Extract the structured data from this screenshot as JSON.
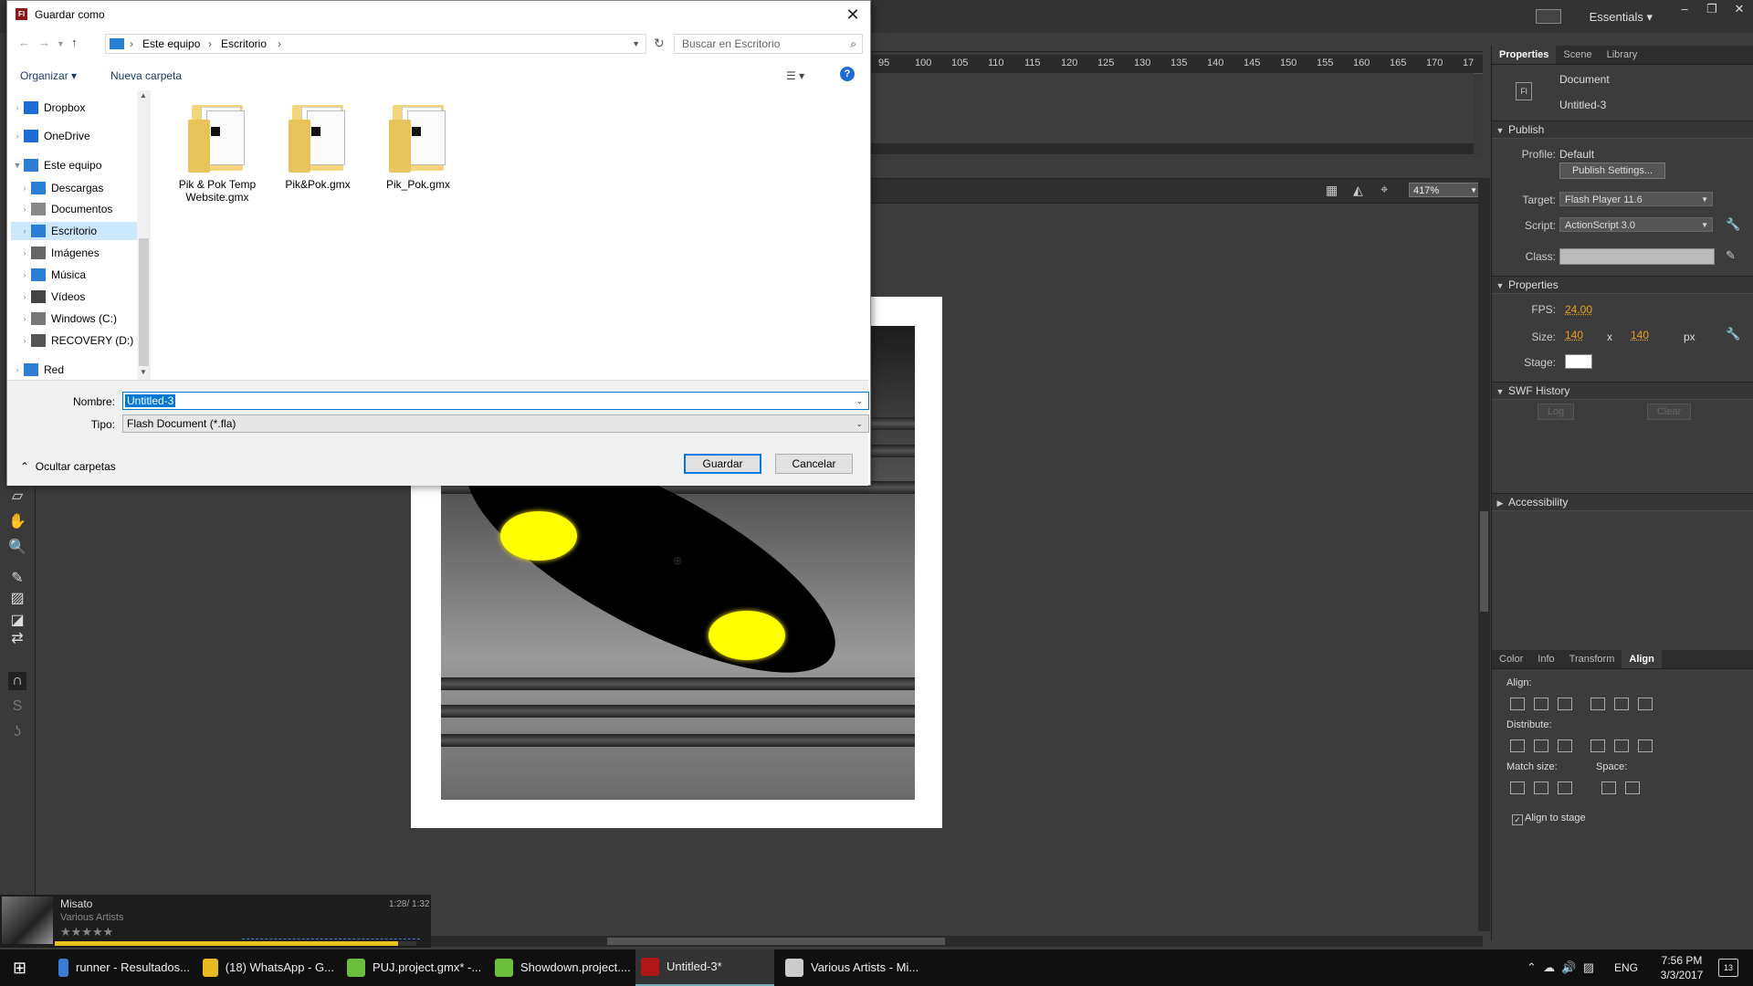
{
  "dialog": {
    "title": "Guardar como",
    "close_glyph": "✕",
    "breadcrumb": [
      "Este equipo",
      "Escritorio"
    ],
    "search_placeholder": "Buscar en Escritorio",
    "organize_label": "Organizar ▾",
    "new_folder_label": "Nueva carpeta",
    "nav_items": [
      {
        "label": "Dropbox",
        "icon": "dropbox-icon",
        "color": "#1e6bd8"
      },
      {
        "label": "OneDrive",
        "icon": "onedrive-icon",
        "color": "#1e6bd8"
      },
      {
        "label": "Este equipo",
        "icon": "computer-icon",
        "color": "#2a7fd4"
      },
      {
        "label": "Descargas",
        "icon": "downloads-icon",
        "color": "#2a7fd4"
      },
      {
        "label": "Documentos",
        "icon": "documents-icon",
        "color": "#888888"
      },
      {
        "label": "Escritorio",
        "icon": "desktop-icon",
        "color": "#2a7fd4"
      },
      {
        "label": "Imágenes",
        "icon": "pictures-icon",
        "color": "#666666"
      },
      {
        "label": "Música",
        "icon": "music-icon",
        "color": "#2a7fd4"
      },
      {
        "label": "Vídeos",
        "icon": "videos-icon",
        "color": "#444444"
      },
      {
        "label": "Windows (C:)",
        "icon": "drive-icon",
        "color": "#777777"
      },
      {
        "label": "RECOVERY (D:)",
        "icon": "drive-icon",
        "color": "#555555"
      },
      {
        "label": "Red",
        "icon": "network-icon",
        "color": "#2a7fd4"
      }
    ],
    "files": [
      {
        "name": "Pik & Pok Temp Website.gmx"
      },
      {
        "name": "Pik&Pok.gmx"
      },
      {
        "name": "Pik_Pok.gmx"
      }
    ],
    "name_label": "Nombre:",
    "name_value": "Untitled-3",
    "type_label": "Tipo:",
    "type_value": "Flash Document (*.fla)",
    "hide_folders_label": "Ocultar carpetas",
    "save_label": "Guardar",
    "cancel_label": "Cancelar"
  },
  "ide": {
    "workspace": "Essentials",
    "ruler_ticks": [
      "95",
      "100",
      "105",
      "110",
      "115",
      "120",
      "125",
      "130",
      "135",
      "140",
      "145",
      "150",
      "155",
      "160",
      "165",
      "170",
      "17"
    ],
    "zoom": "417%"
  },
  "panel": {
    "tabs": [
      "Properties",
      "Scene",
      "Library"
    ],
    "doc_type": "Document",
    "doc_name": "Untitled-3",
    "publish_header": "Publish",
    "profile_label": "Profile:",
    "profile_value": "Default",
    "publish_settings": "Publish Settings...",
    "target_label": "Target:",
    "target_value": "Flash Player 11.6",
    "script_label": "Script:",
    "script_value": "ActionScript 3.0",
    "class_label": "Class:",
    "properties_header": "Properties",
    "fps_label": "FPS:",
    "fps_value": "24.00",
    "size_label": "Size:",
    "width_value": "140",
    "x_sep": "x",
    "height_value": "140",
    "unit": "px",
    "stage_label": "Stage:",
    "stage_color": "#ffffff",
    "swf_header": "SWF History",
    "log_label": "Log",
    "clear_label": "Clear",
    "accessibility_header": "Accessibility",
    "align_tabs": [
      "Color",
      "Info",
      "Transform",
      "Align"
    ],
    "align_label": "Align:",
    "distribute_label": "Distribute:",
    "match_size_label": "Match size:",
    "space_label": "Space:",
    "align_to_stage": "Align to stage"
  },
  "music": {
    "title": "Misato",
    "artist": "Various Artists",
    "time": "1:28/ 1:32",
    "progress": 0.95,
    "rating_stars": "★★★★★"
  },
  "taskbar": {
    "items": [
      {
        "label": "runner - Resultados...",
        "icon_color": "#3a7bd5"
      },
      {
        "label": "(18) WhatsApp - G...",
        "icon_color": "#e8b820"
      },
      {
        "label": "PUJ.project.gmx* -...",
        "icon_color": "#6bbf3a"
      },
      {
        "label": "Showdown.project....",
        "icon_color": "#6bbf3a"
      },
      {
        "label": "Untitled-3*",
        "icon_color": "#b01818"
      },
      {
        "label": "Various Artists - Mi...",
        "icon_color": "#cccccc"
      }
    ],
    "lang": "ENG",
    "time": "7:56 PM",
    "date": "3/3/2017",
    "notifications": "13"
  }
}
